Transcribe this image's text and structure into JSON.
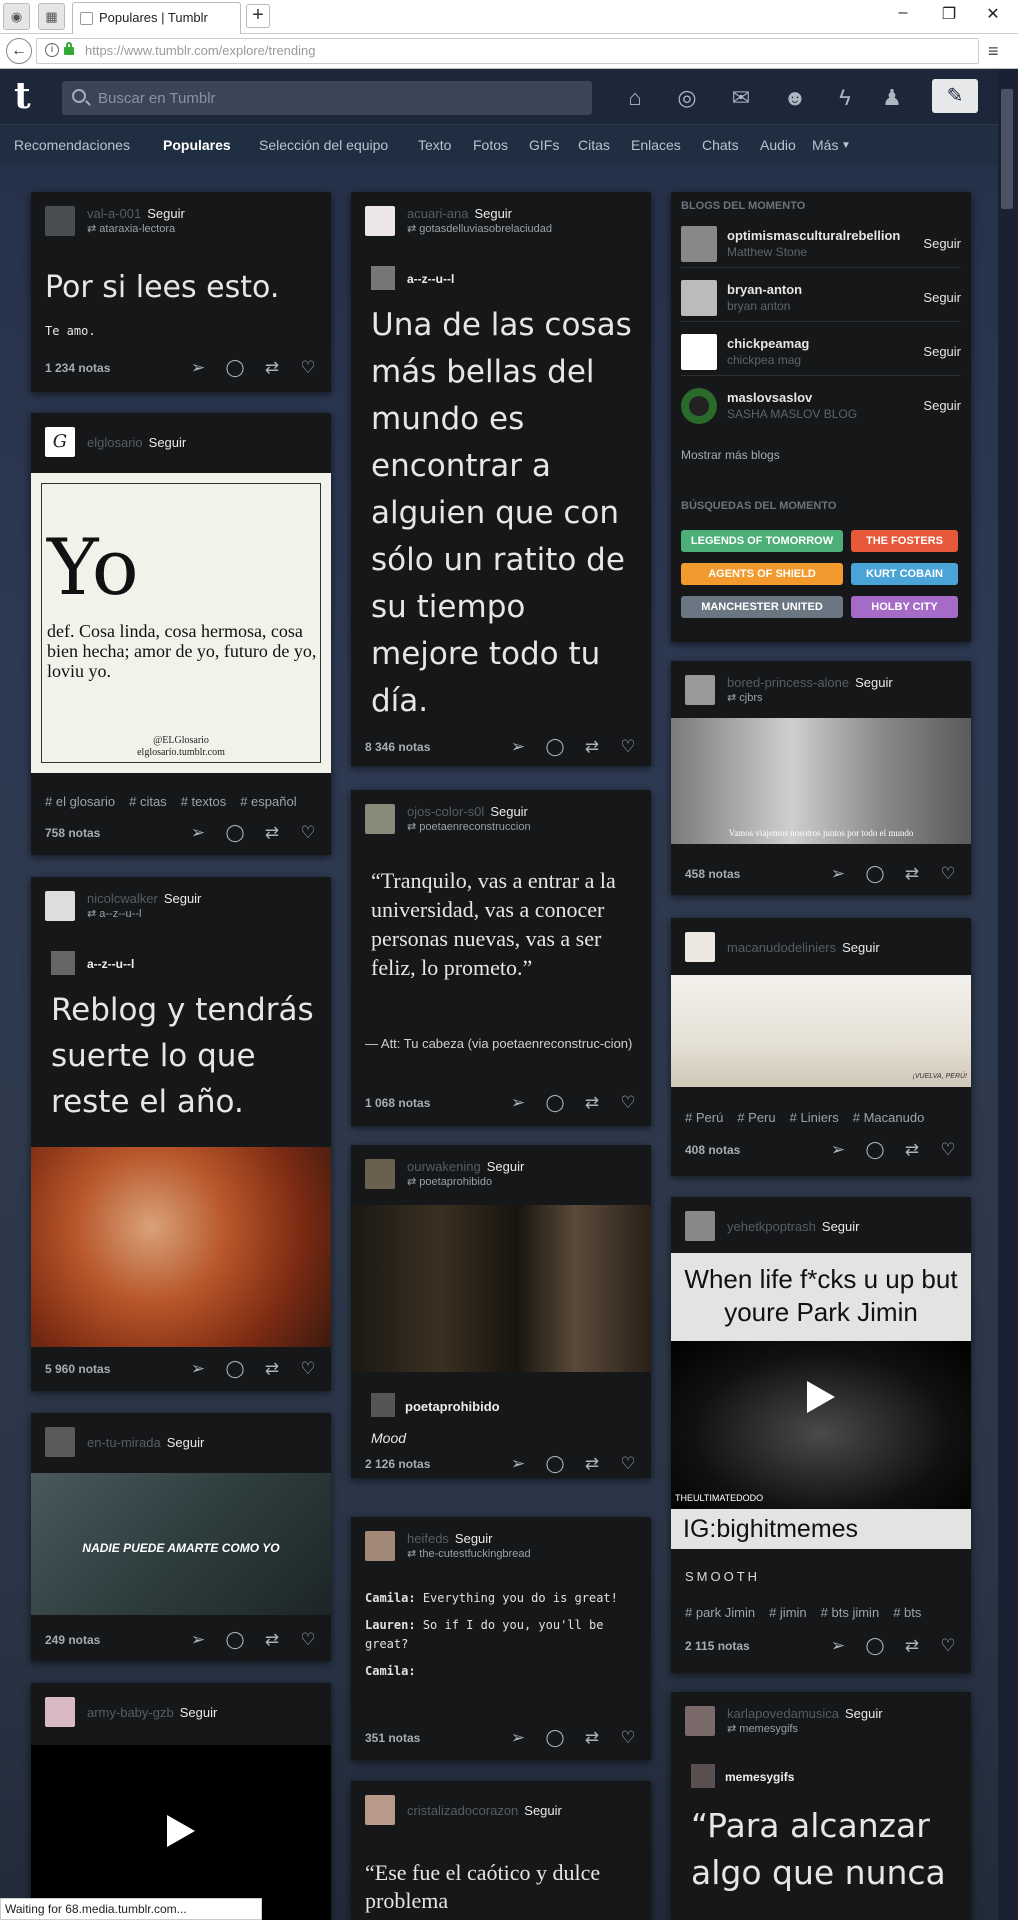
{
  "browser": {
    "tab_title": "Populares | Tumblr",
    "url": "https://www.tumblr.com/explore/trending",
    "status": "Waiting for 68.media.tumblr.com..."
  },
  "header": {
    "logo": "t",
    "search_placeholder": "Buscar en Tumblr"
  },
  "nav": {
    "items": [
      "Recomendaciones",
      "Populares",
      "Selección del equipo",
      "Texto",
      "Fotos",
      "GIFs",
      "Citas",
      "Enlaces",
      "Chats",
      "Audio",
      "Más"
    ],
    "active": "Populares"
  },
  "follow_label": "Seguir",
  "posts": {
    "p1": {
      "user": "val-a-001",
      "reblog": "ataraxia-lectora",
      "title": "Por si lees esto.",
      "body": "Te amo.",
      "notes": "1 234 notas"
    },
    "p2": {
      "user": "elglosario",
      "img_word": "Yo",
      "img_def": "def. Cosa linda, cosa hermosa, cosa bien hecha; amor de yo, futuro de yo, loviu yo.",
      "img_credit1": "@ELGlosario",
      "img_credit2": "elglosario.tumblr.com",
      "tags": [
        "# el glosario",
        "# citas",
        "# textos",
        "# español"
      ],
      "notes": "758 notas"
    },
    "p3": {
      "user": "nicolcwalker",
      "reblog": "a--z--u--l",
      "inner_user": "a--z--u--l",
      "title": "Reblog y tendrás suerte lo que reste el año.",
      "notes": "5 960 notas"
    },
    "p4": {
      "user": "en-tu-mirada",
      "caption": "NADIE PUEDE AMARTE COMO YO",
      "notes": "249 notas"
    },
    "p5": {
      "user": "army-baby-gzb"
    },
    "p6": {
      "user": "acuari-ana",
      "reblog": "gotasdelluviasobrelaciudad",
      "inner_user": "a--z--u--l",
      "title": "Una de las cosas más bellas del mundo es encontrar a alguien que con sólo un ratito de su tiempo mejore todo tu día.",
      "notes": "8 346 notas"
    },
    "p7": {
      "user": "ojos-color-s0l",
      "reblog": "poetaenreconstruccion",
      "quote": "“Tranquilo, vas a entrar a la universidad, vas a conocer personas nuevas, vas a ser feliz, lo prometo.”",
      "source": "— Att: Tu cabeza (via poetaenreconstruc-cion)",
      "notes": "1 068 notas"
    },
    "p8": {
      "user": "ourwakening",
      "reblog": "poetaprohibido",
      "inner_user": "poetaprohibido",
      "caption": "Mood",
      "notes": "2 126 notas"
    },
    "p9": {
      "user": "heifeds",
      "reblog": "the-cutestfuckingbread",
      "chat": [
        {
          "speaker": "Camila:",
          "line": "Everything you do is great!"
        },
        {
          "speaker": "Lauren:",
          "line": "So if I do you, you'll be great?"
        },
        {
          "speaker": "Camila:",
          "line": ""
        }
      ],
      "notes": "351 notas"
    },
    "p10": {
      "user": "cristalizadocorazon",
      "quote": "“Ese fue el caótico y dulce problema"
    },
    "p11": {
      "user": "bored-princess-alone",
      "reblog": "cjbrs",
      "img_caption": "Vamos viajemos nosotros juntos por todo el mundo",
      "notes": "458 notas"
    },
    "p12": {
      "user": "macanudodeliniers",
      "tags": [
        "# Perú",
        "# Peru",
        "# Liniers",
        "# Macanudo"
      ],
      "img_caption": "¡VUELVA, PERÚ!",
      "notes": "408 notas"
    },
    "p13": {
      "user": "yehetkpoptrash",
      "top_text": "When life f*cks u up but youre Park Jimin",
      "bottom_text": "IG:bighitmemes",
      "watermark": "THEULTIMATEDODO",
      "body": "SMOOTH",
      "tags": [
        "# park Jimin",
        "# jimin",
        "# bts jimin",
        "# bts"
      ],
      "notes": "2 115 notas"
    },
    "p14": {
      "user": "karlapovedamusica",
      "reblog": "memesygifs",
      "inner_user": "memesygifs",
      "title": "“Para alcanzar algo que nunca"
    }
  },
  "sidebar": {
    "blogs_heading": "BLOGS DEL MOMENTO",
    "blogs": [
      {
        "name": "optimismasculturalrebellion",
        "sub": "Matthew Stone"
      },
      {
        "name": "bryan-anton",
        "sub": "bryan anton"
      },
      {
        "name": "chickpeamag",
        "sub": "chickpea mag"
      },
      {
        "name": "maslovsaslov",
        "sub": "SASHA MASLOV BLOG"
      }
    ],
    "more_blogs": "Mostrar más blogs",
    "searches_heading": "BÚSQUEDAS DEL MOMENTO",
    "searches": [
      {
        "label": "LEGENDS OF TOMORROW",
        "color": "#4caf78"
      },
      {
        "label": "THE FOSTERS",
        "color": "#e8583a"
      },
      {
        "label": "AGENTS OF SHIELD",
        "color": "#f29a2e"
      },
      {
        "label": "KURT COBAIN",
        "color": "#4aa4d8"
      },
      {
        "label": "MANCHESTER UNITED",
        "color": "#6b7683"
      },
      {
        "label": "HOLBY CITY",
        "color": "#a56bc6"
      }
    ]
  }
}
